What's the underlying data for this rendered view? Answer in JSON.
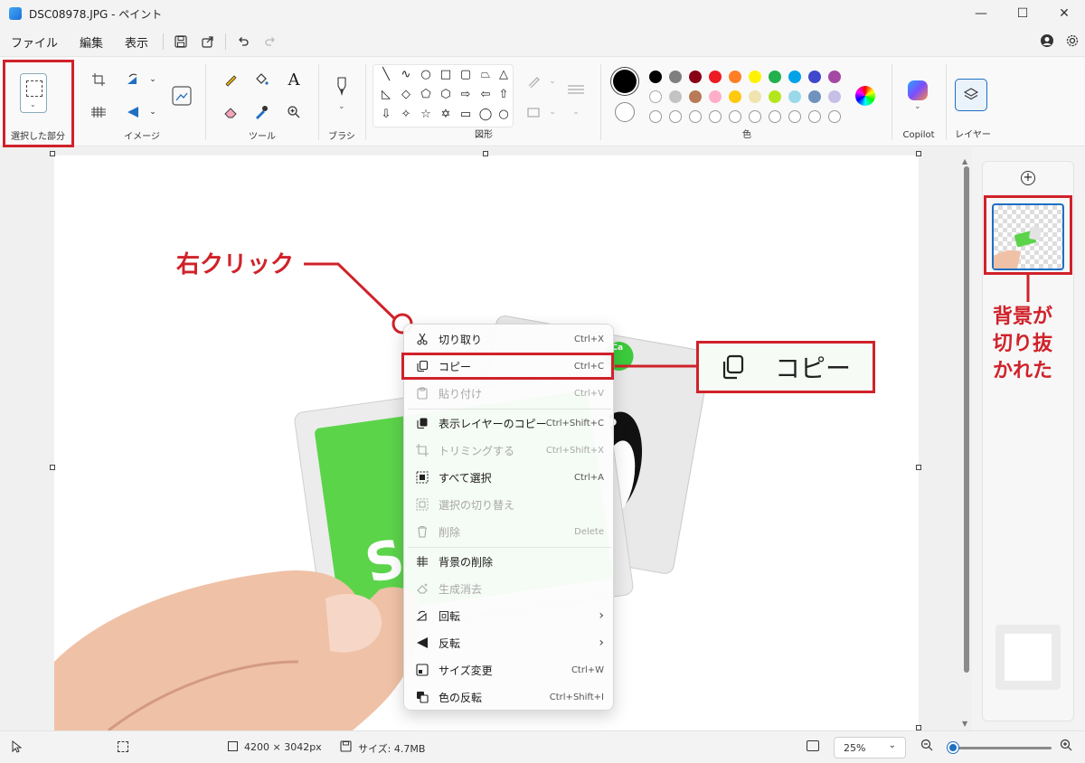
{
  "window": {
    "title": "DSC08978.JPG - ペイント"
  },
  "menu": {
    "file": "ファイル",
    "edit": "編集",
    "view": "表示"
  },
  "ribbon": {
    "selection": "選択した部分",
    "image": "イメージ",
    "tools": "ツール",
    "brush": "ブラシ",
    "shapes": "図形",
    "colors": "色",
    "copilot": "Copilot",
    "layers": "レイヤー",
    "text_tool_glyph": "A"
  },
  "palette": {
    "row1": [
      "#000000",
      "#7f7f7f",
      "#880015",
      "#ed1c24",
      "#ff7f27",
      "#fff200",
      "#22b14c",
      "#00a2e8",
      "#3f48cc",
      "#a349a4"
    ],
    "row2": [
      "#ffffff",
      "#c3c3c3",
      "#b97a57",
      "#ffaec9",
      "#ffc90e",
      "#efe4b0",
      "#b5e61d",
      "#99d9ea",
      "#7092be",
      "#c8bfe7"
    ],
    "primary": "#000000",
    "secondary": "#ffffff",
    "accent": "#d0222a"
  },
  "context_menu": [
    {
      "label": "切り取り",
      "shortcut": "Ctrl+X",
      "icon": "scissors-icon",
      "enabled": true
    },
    {
      "label": "コピー",
      "shortcut": "Ctrl+C",
      "icon": "copy-icon",
      "enabled": true,
      "highlighted": true
    },
    {
      "label": "貼り付け",
      "shortcut": "Ctrl+V",
      "icon": "paste-icon",
      "enabled": false
    },
    {
      "label": "表示レイヤーのコピー",
      "shortcut": "Ctrl+Shift+C",
      "icon": "copy-layer-icon",
      "enabled": true
    },
    {
      "label": "トリミングする",
      "shortcut": "Ctrl+Shift+X",
      "icon": "crop-icon",
      "enabled": false
    },
    {
      "label": "すべて選択",
      "shortcut": "Ctrl+A",
      "icon": "select-all-icon",
      "enabled": true
    },
    {
      "label": "選択の切り替え",
      "shortcut": "",
      "icon": "invert-selection-icon",
      "enabled": false
    },
    {
      "label": "削除",
      "shortcut": "Delete",
      "icon": "trash-icon",
      "enabled": false
    },
    {
      "label": "背景の削除",
      "shortcut": "",
      "icon": "remove-background-icon",
      "enabled": true
    },
    {
      "label": "生成消去",
      "shortcut": "",
      "icon": "generative-erase-icon",
      "enabled": false
    },
    {
      "label": "回転",
      "shortcut": "›",
      "icon": "rotate-icon",
      "enabled": true
    },
    {
      "label": "反転",
      "shortcut": "›",
      "icon": "flip-icon",
      "enabled": true
    },
    {
      "label": "サイズ変更",
      "shortcut": "Ctrl+W",
      "icon": "resize-icon",
      "enabled": true
    },
    {
      "label": "色の反転",
      "shortcut": "Ctrl+Shift+I",
      "icon": "invert-color-icon",
      "enabled": true
    }
  ],
  "annotations": {
    "right_click": "右クリック",
    "copy_callout": "コピー",
    "bg_removed_line1": "背景が",
    "bg_removed_line2": "切り抜",
    "bg_removed_line3": "かれた"
  },
  "canvas_text": {
    "card_letter": "S",
    "card_badge": "ICa"
  },
  "status": {
    "dimensions": "4200 × 3042px",
    "size": "サイズ: 4.7MB",
    "zoom": "25%"
  }
}
